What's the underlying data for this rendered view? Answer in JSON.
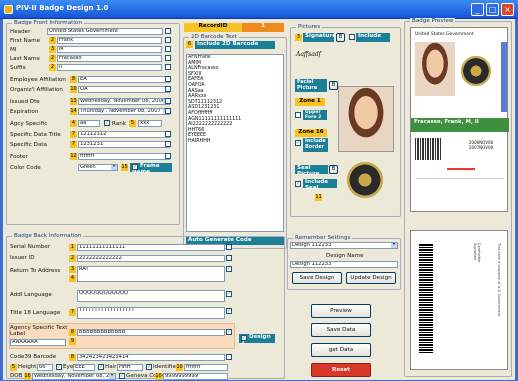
{
  "window": {
    "title": "PIV-II Badge Design 1.0"
  },
  "front": {
    "legend": "Badge Front Information",
    "fields": [
      {
        "label": "Header",
        "num": "1",
        "value": "United States Government"
      },
      {
        "label": "First Name",
        "num": "2",
        "value": "Frank"
      },
      {
        "label": "MI",
        "num": "3",
        "value": "M"
      },
      {
        "label": "Last Name",
        "num": "2",
        "value": "Fracasso"
      },
      {
        "label": "Suffix",
        "num": "2",
        "value": "II"
      },
      {
        "label": "Employee Affiliation",
        "num": "8",
        "value": "EA"
      },
      {
        "label": "Organiz'l Affiliation",
        "num": "10",
        "value": "OA"
      },
      {
        "label": "Issued Dte",
        "num": "13",
        "value": "Wednesday, November 08, 2006"
      },
      {
        "label": "Expiration",
        "num": "14",
        "value": "Thursday , November 08, 2007"
      },
      {
        "label": "Agcy Specific",
        "num": "4",
        "value": "aa"
      },
      {
        "label": "Specific Data Title",
        "num": "7",
        "value": "12112312"
      },
      {
        "label": "Specific Data",
        "num": "7",
        "value": "1231231"
      },
      {
        "label": "Footer",
        "num": "12",
        "value": "ffffffff"
      },
      {
        "label": "Color Code",
        "num": "",
        "value": "Green"
      }
    ],
    "rank_label": "Rank",
    "rank_num": "5",
    "rank_value": "xxx",
    "frame_num": "15",
    "frame_label": "Frame Name"
  },
  "record": {
    "label": "RecordID",
    "value": "1"
  },
  "barcode2d": {
    "legend": "2D Barcode Text",
    "num": "6",
    "include_label": "Include 2D Barcode",
    "lines": [
      "AFNFrank",
      "AMIM",
      "ALNFracasso",
      "SFXIII",
      "EAFEA",
      "OAFOA",
      "AASaa",
      "AARxxx",
      "SDT12112312",
      "ASD1231231",
      "AFOfffffffff",
      "AGN11111111111111",
      "AI2222222222222",
      "HHT66",
      "EYEEEE",
      "HAIRHHH"
    ],
    "auto_label": "Auto Generate Code"
  },
  "pictures": {
    "legend": "Pictures",
    "sig_num": "3",
    "sig_label": "Signature",
    "sig_b": "B",
    "include_label": "Include",
    "sig_text": "Aaffsadf",
    "facial_label": "Facial Picture",
    "facial_b": "B",
    "zone1": "Zone 1",
    "zone1_sub": "Upper Fore 2",
    "zone16": "Zone 16",
    "include_border": "Include Border",
    "seal_label": "Seal Picture",
    "seal_b": "B",
    "include_seal": "Include Seal",
    "seal_num": "11"
  },
  "preview": {
    "legend": "Badge Preview",
    "header": "United States Government",
    "name": "Fracasso, Frank, M, II",
    "side_text": "EA OA",
    "dates": "2006NOV08 2007NOV08"
  },
  "back": {
    "legend": "Badge Back Information",
    "serial": {
      "label": "Serial Number",
      "num": "1",
      "value": "11111111111111"
    },
    "issuer": {
      "label": "Issuer ID",
      "num": "2",
      "value": "2222222222222"
    },
    "return": {
      "label": "Return To Address",
      "num": "3",
      "num2": "4",
      "value": "RAT"
    },
    "addl": {
      "label": "Addl Language",
      "value": "QQQQQQQQQQQQ"
    },
    "title18": {
      "label": "Title 18 Language",
      "num": "7",
      "value": "TTTTTTTTTTTTTTTTTT"
    },
    "agency": {
      "label": "Agency Specific Text Label",
      "num": "8",
      "num2": "9",
      "value": "BBBBBBBBBBBBB",
      "value2": "AAAAAAA"
    },
    "code39": {
      "label": "Code39 Barcode",
      "num": "8",
      "value": "342423423423414"
    },
    "design2": "Design 2",
    "height": {
      "label": "Height",
      "num": "5",
      "value": "66"
    },
    "eye": {
      "label": "Eye",
      "value": "EEE"
    },
    "hair": {
      "label": "Hair",
      "value": "HHH"
    },
    "identifier": {
      "label": "Identifier",
      "num": "10",
      "value": "ffffffff"
    },
    "dob": {
      "label": "DOB",
      "num": "16",
      "value": "Wednesday, November 08, 2006"
    },
    "geneva": {
      "label": "Geneva Conv",
      "num": "10",
      "value": "9999999999"
    }
  },
  "settings": {
    "legend": "Remember Settings",
    "select": "Design 112233",
    "design_name_label": "Design Name",
    "design_name": "Design 112233",
    "save": "Save Design",
    "update": "Update Design"
  },
  "actions": {
    "preview": "Preview",
    "save": "Save Data",
    "get": "get Data",
    "reset": "Reset"
  },
  "back_preview": {
    "text1": "Cardholder Signature",
    "text2": "This card is property of U.S. Government"
  },
  "colors": {
    "title": "#1553d6",
    "accent": "#f6c224",
    "teal": "#1b7f97",
    "reset": "#d8382c",
    "preview_green": "#4aa64a"
  }
}
